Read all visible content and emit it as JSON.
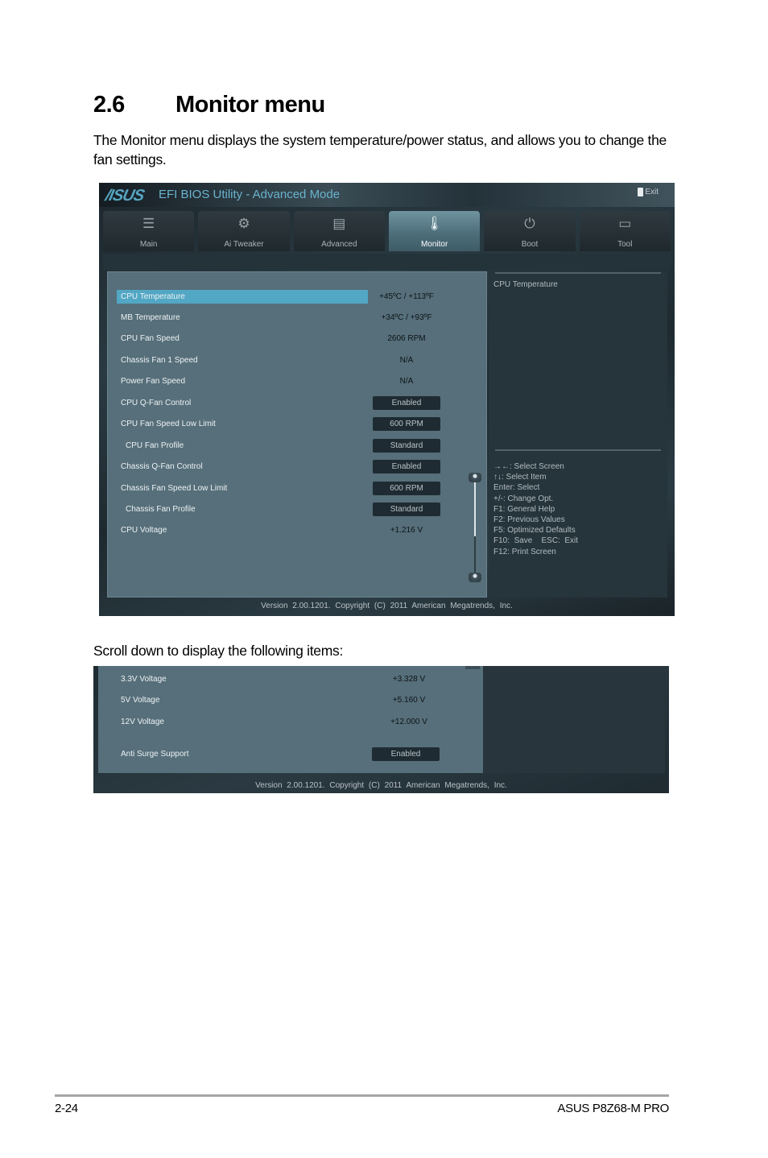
{
  "document": {
    "section_number": "2.6",
    "section_title": "Monitor menu",
    "intro": "The Monitor menu displays the system temperature/power status, and allows you to change the fan settings.",
    "scroll_note": "Scroll down to display the following items:",
    "page_number": "2-24",
    "product_name": "ASUS P8Z68-M PRO"
  },
  "bios": {
    "logo": "/ISUS",
    "title": "EFI BIOS Utility - Advanced Mode",
    "exit_label": "Exit",
    "tabs": [
      {
        "label": "Main",
        "icon": "list-icon",
        "glyph": "☰"
      },
      {
        "label": "Ai  Tweaker",
        "icon": "tweaker-icon",
        "glyph": "⚙"
      },
      {
        "label": "Advanced",
        "icon": "advanced-icon",
        "glyph": "▤"
      },
      {
        "label": "Monitor",
        "icon": "monitor-thermometer-icon",
        "glyph": "🌡",
        "active": true
      },
      {
        "label": "Boot",
        "icon": "power-icon",
        "glyph": "⏻"
      },
      {
        "label": "Tool",
        "icon": "toolbox-icon",
        "glyph": "▭"
      }
    ],
    "items": [
      {
        "label": "CPU Temperature",
        "value": "+45ºC / +113ºF",
        "type": "text",
        "selected": true
      },
      {
        "label": "MB Temperature",
        "value": "+34ºC / +93ºF",
        "type": "text"
      },
      {
        "label": "CPU Fan Speed",
        "value": "2606 RPM",
        "type": "text"
      },
      {
        "label": "Chassis Fan 1 Speed",
        "value": "N/A",
        "type": "text"
      },
      {
        "label": "Power Fan Speed",
        "value": "N/A",
        "type": "text"
      },
      {
        "label": "CPU Q-Fan Control",
        "value": "Enabled",
        "type": "option"
      },
      {
        "label": "CPU Fan Speed Low Limit",
        "value": "600 RPM",
        "type": "option"
      },
      {
        "label": "CPU Fan Profile",
        "value": "Standard",
        "type": "option",
        "indent": true
      },
      {
        "label": "Chassis Q-Fan Control",
        "value": "Enabled",
        "type": "option"
      },
      {
        "label": "Chassis Fan Speed Low Limit",
        "value": "600 RPM",
        "type": "option"
      },
      {
        "label": "Chassis Fan Profile",
        "value": "Standard",
        "type": "option",
        "indent": true
      },
      {
        "label": "CPU Voltage",
        "value": "+1.216 V",
        "type": "text"
      }
    ],
    "scroll_position": 0.6,
    "help_title": "CPU Temperature",
    "key_help": [
      "→←:  Select Screen",
      "↑↓:  Select Item",
      "Enter:  Select",
      "+/-:  Change Opt.",
      "F1:  General Help",
      "F2:  Previous Values",
      "F5:  Optimized Defaults",
      "F10:  Save    ESC:  Exit",
      "F12: Print Screen"
    ],
    "footer": "Version 2.00.1201. Copyright (C) 2011 American Megatrends, Inc."
  },
  "bios_scrolled": {
    "items": [
      {
        "label": "3.3V Voltage",
        "value": "+3.328 V",
        "type": "text"
      },
      {
        "label": "5V Voltage",
        "value": "+5.160 V",
        "type": "text"
      },
      {
        "label": "12V Voltage",
        "value": "+12.000 V",
        "type": "text"
      },
      {
        "label": "Anti Surge Support",
        "value": "Enabled",
        "type": "option"
      }
    ],
    "footer": "Version 2.00.1201. Copyright (C) 2011 American Megatrends, Inc."
  }
}
